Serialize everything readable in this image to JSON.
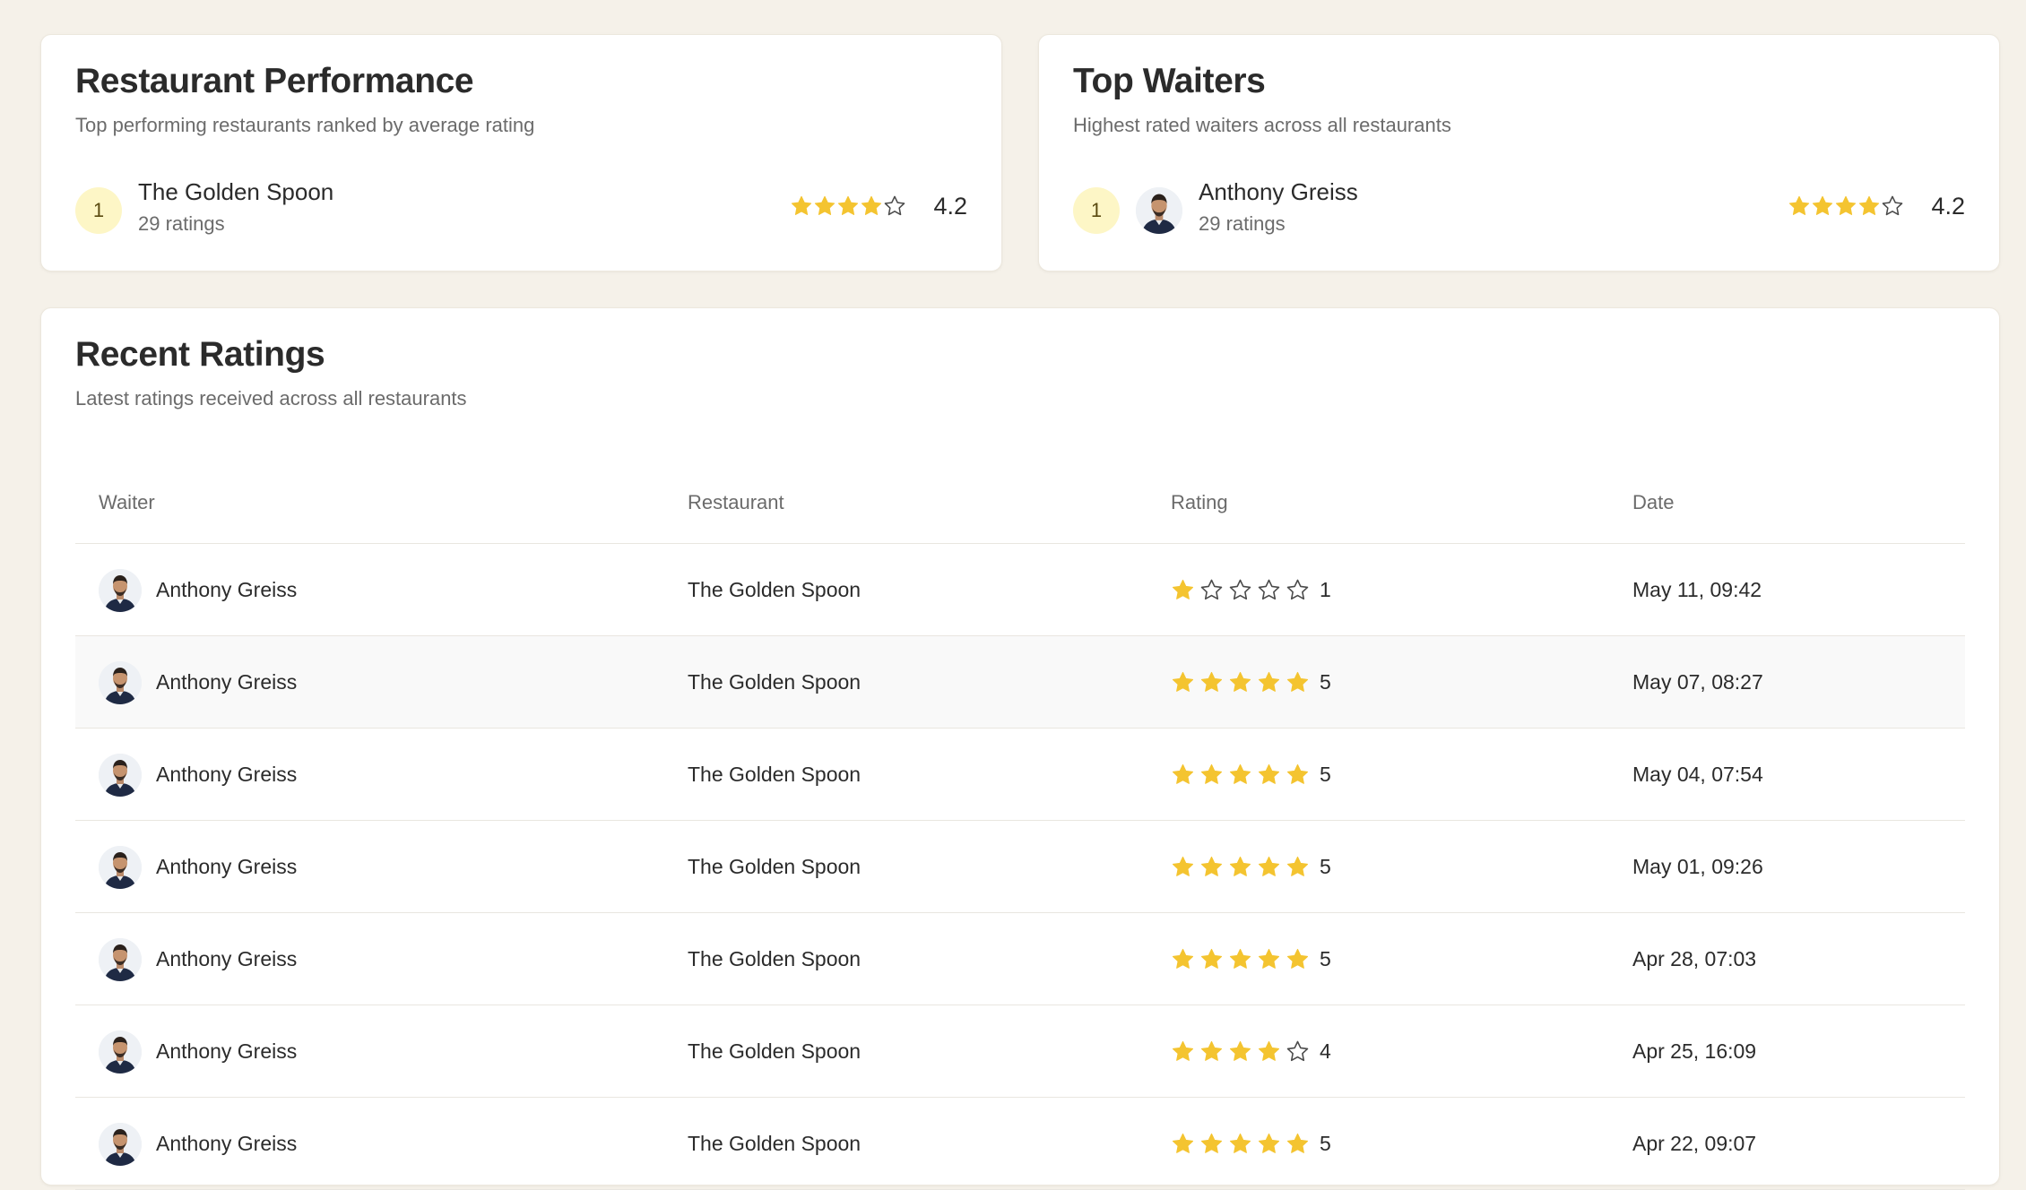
{
  "colors": {
    "background": "#f5f1e9",
    "star_filled": "#f4c430",
    "star_empty_stroke": "#4a4a4a",
    "rank_badge": "#fdf6c6"
  },
  "restaurant_performance": {
    "title": "Restaurant Performance",
    "subtitle": "Top performing restaurants ranked by average rating",
    "items": [
      {
        "rank": "1",
        "name": "The Golden Spoon",
        "ratings_label": "29 ratings",
        "stars": 4,
        "score": "4.2"
      }
    ]
  },
  "top_waiters": {
    "title": "Top Waiters",
    "subtitle": "Highest rated waiters across all restaurants",
    "items": [
      {
        "rank": "1",
        "name": "Anthony Greiss",
        "ratings_label": "29 ratings",
        "stars": 4,
        "score": "4.2",
        "avatar_icon": "person-avatar"
      }
    ]
  },
  "recent_ratings": {
    "title": "Recent Ratings",
    "subtitle": "Latest ratings received across all restaurants",
    "columns": [
      "Waiter",
      "Restaurant",
      "Rating",
      "Date"
    ],
    "rows": [
      {
        "waiter": "Anthony Greiss",
        "restaurant": "The Golden Spoon",
        "rating": 1,
        "rating_label": "1",
        "date": "May 11, 09:42"
      },
      {
        "waiter": "Anthony Greiss",
        "restaurant": "The Golden Spoon",
        "rating": 5,
        "rating_label": "5",
        "date": "May 07, 08:27"
      },
      {
        "waiter": "Anthony Greiss",
        "restaurant": "The Golden Spoon",
        "rating": 5,
        "rating_label": "5",
        "date": "May 04, 07:54"
      },
      {
        "waiter": "Anthony Greiss",
        "restaurant": "The Golden Spoon",
        "rating": 5,
        "rating_label": "5",
        "date": "May 01, 09:26"
      },
      {
        "waiter": "Anthony Greiss",
        "restaurant": "The Golden Spoon",
        "rating": 5,
        "rating_label": "5",
        "date": "Apr 28, 07:03"
      },
      {
        "waiter": "Anthony Greiss",
        "restaurant": "The Golden Spoon",
        "rating": 4,
        "rating_label": "4",
        "date": "Apr 25, 16:09"
      },
      {
        "waiter": "Anthony Greiss",
        "restaurant": "The Golden Spoon",
        "rating": 5,
        "rating_label": "5",
        "date": "Apr 22, 09:07"
      }
    ]
  }
}
